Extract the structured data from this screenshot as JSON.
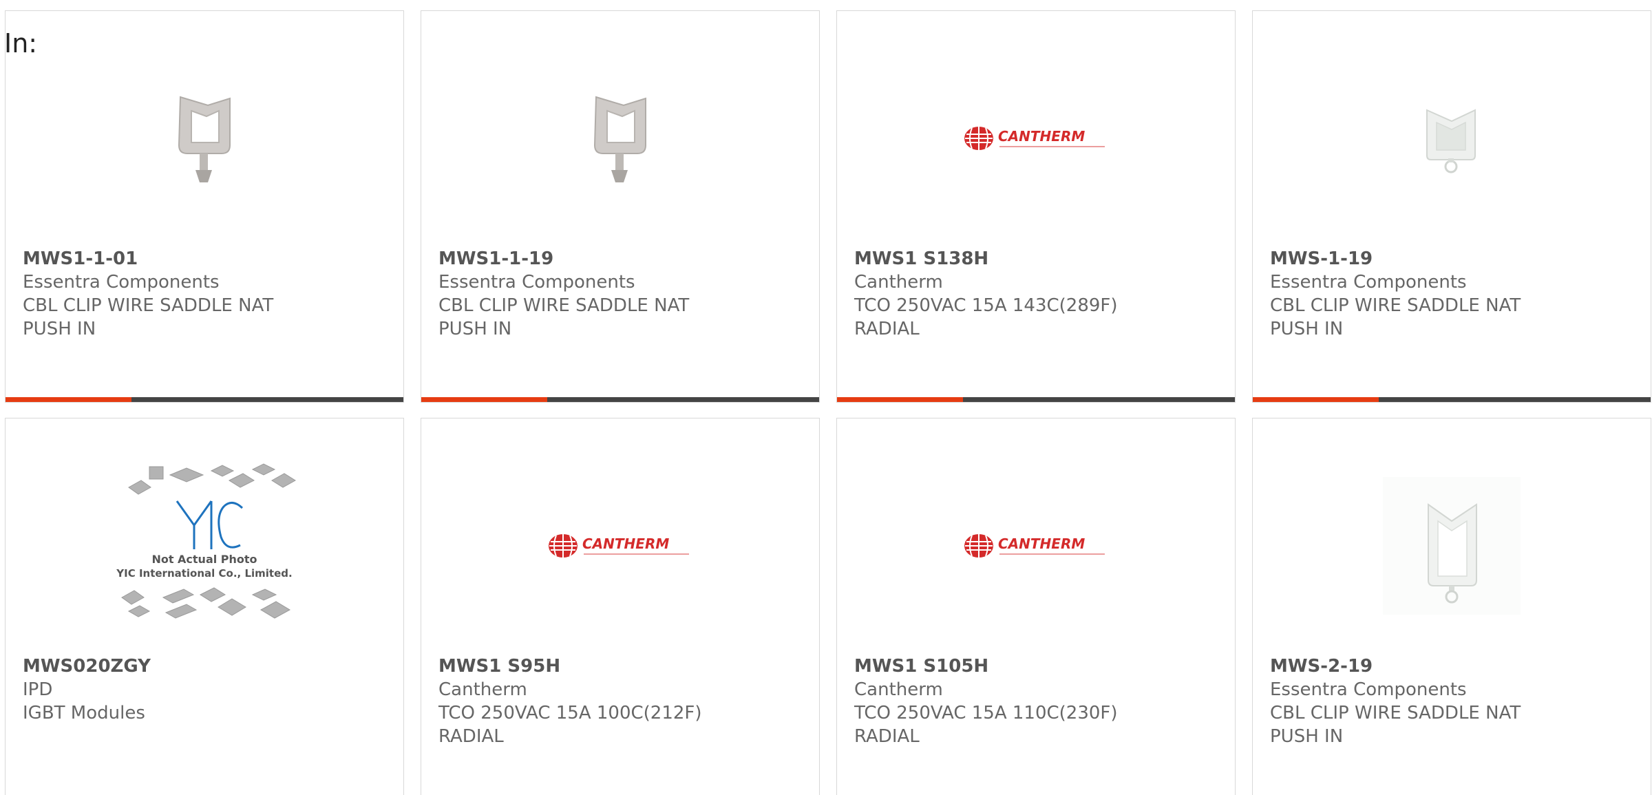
{
  "header": {
    "prefix": "In:"
  },
  "colors": {
    "accent": "#e63c12",
    "bar": "#444444",
    "border": "#d8d8d8",
    "text": "#666666"
  },
  "products": [
    {
      "part": "MWS1-1-01",
      "maker": "Essentra Components",
      "desc1": "CBL CLIP WIRE SADDLE NAT",
      "desc2": "PUSH IN",
      "image": "wire-saddle-clip-icon"
    },
    {
      "part": "MWS1-1-19",
      "maker": "Essentra Components",
      "desc1": "CBL CLIP WIRE SADDLE NAT",
      "desc2": "PUSH IN",
      "image": "wire-saddle-clip-icon"
    },
    {
      "part": "MWS1 S138H",
      "maker": "Cantherm",
      "desc1": "TCO 250VAC 15A 143C(289F)",
      "desc2": "RADIAL",
      "image": "cantherm-logo",
      "logo_text": "CANTHERM"
    },
    {
      "part": "MWS-1-19",
      "maker": "Essentra Components",
      "desc1": "CBL CLIP WIRE SADDLE NAT",
      "desc2": "PUSH IN",
      "image": "wire-saddle-clip-white-icon"
    },
    {
      "part": "MWS020ZGY",
      "maker": "IPD",
      "desc1": "IGBT Modules",
      "desc2": "",
      "image": "yic-placeholder-photo",
      "placeholder_line1": "Not Actual Photo",
      "placeholder_line2": "YIC International Co., Limited."
    },
    {
      "part": "MWS1 S95H",
      "maker": "Cantherm",
      "desc1": "TCO 250VAC 15A 100C(212F)",
      "desc2": "RADIAL",
      "image": "cantherm-logo",
      "logo_text": "CANTHERM"
    },
    {
      "part": "MWS1 S105H",
      "maker": "Cantherm",
      "desc1": "TCO 250VAC 15A 110C(230F)",
      "desc2": "RADIAL",
      "image": "cantherm-logo",
      "logo_text": "CANTHERM"
    },
    {
      "part": "MWS-2-19",
      "maker": "Essentra Components",
      "desc1": "CBL CLIP WIRE SADDLE NAT",
      "desc2": "PUSH IN",
      "image": "wire-saddle-clip-white-icon"
    }
  ]
}
